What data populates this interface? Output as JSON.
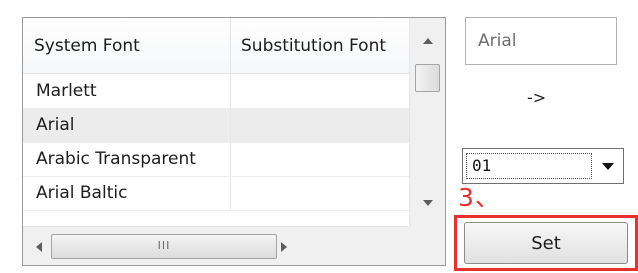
{
  "font_table": {
    "columns": [
      "System Font",
      "Substitution Font"
    ],
    "rows": [
      {
        "system": "Marlett",
        "substitution": ""
      },
      {
        "system": "Arial",
        "substitution": ""
      },
      {
        "system": "Arabic Transparent",
        "substitution": ""
      },
      {
        "system": "Arial Baltic",
        "substitution": ""
      }
    ],
    "selected_row": "Arial",
    "h_scroll_grip": "III"
  },
  "controls": {
    "font_field_value": "Arial",
    "arrow_text": "->",
    "charset_select_value": "01",
    "step_label": "3、",
    "set_label": "Set"
  },
  "colors": {
    "highlight": "#e8302f",
    "selected_row_bg": "#ececec"
  }
}
